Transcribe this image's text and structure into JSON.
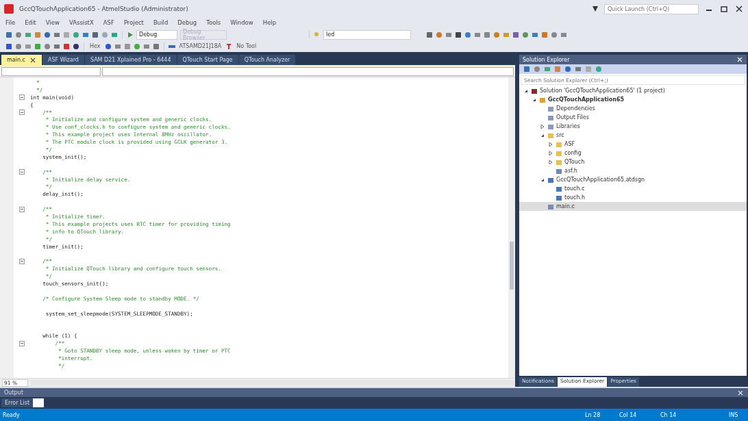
{
  "window": {
    "title": "GccQTouchApplication65 - AtmelStudio (Administrator)",
    "quick_launch_placeholder": "Quick Launch (Ctrl+Q)"
  },
  "menu": [
    "File",
    "Edit",
    "View",
    "VAssistX",
    "ASF",
    "Project",
    "Build",
    "Debug",
    "Tools",
    "Window",
    "Help"
  ],
  "toolbar": {
    "configuration": "Debug",
    "debug_browser": "Debug Browser",
    "find_value": "led",
    "hex_label": "Hex",
    "device": "ATSAMD21J18A",
    "tool": "No Tool"
  },
  "document_tabs": [
    {
      "label": "main.c",
      "selected": true
    },
    {
      "label": "ASF Wizard",
      "selected": false
    },
    {
      "label": "SAM D21 Xplained Pro - 6444",
      "selected": false
    },
    {
      "label": "QTouch Start Page",
      "selected": false
    },
    {
      "label": "QTouch Analyzer",
      "selected": false
    }
  ],
  "editor": {
    "zoom": "91 %",
    "lines": [
      {
        "kind": "comment",
        "text": "  *",
        "foldable": false
      },
      {
        "kind": "comment",
        "text": "  */",
        "foldable": false
      },
      {
        "kind": "code",
        "text": "int main(void)",
        "foldable": true
      },
      {
        "kind": "code",
        "text": "{",
        "foldable": false
      },
      {
        "kind": "comment",
        "text": "    /**",
        "foldable": true
      },
      {
        "kind": "comment",
        "text": "     * Initialize and configure system and generic clocks.",
        "foldable": false
      },
      {
        "kind": "comment",
        "text": "     * Use conf_clocks.h to configure system and generic clocks.",
        "foldable": false
      },
      {
        "kind": "comment",
        "text": "     * This example project uses Internal 8MHz oscillator.",
        "foldable": false
      },
      {
        "kind": "comment",
        "text": "     * The PTC module clock is provided using GCLK generator 3.",
        "foldable": false
      },
      {
        "kind": "comment",
        "text": "     */",
        "foldable": false
      },
      {
        "kind": "code",
        "text": "    system_init();",
        "foldable": false
      },
      {
        "kind": "blank",
        "foldable": false
      },
      {
        "kind": "comment",
        "text": "    /**",
        "foldable": true
      },
      {
        "kind": "comment",
        "text": "     * Initialize delay service.",
        "foldable": false
      },
      {
        "kind": "comment",
        "text": "     */",
        "foldable": false
      },
      {
        "kind": "code",
        "text": "    delay_init();",
        "foldable": false
      },
      {
        "kind": "blank",
        "foldable": false
      },
      {
        "kind": "comment",
        "text": "    /**",
        "foldable": true
      },
      {
        "kind": "comment",
        "text": "     * Initialize timer.",
        "foldable": false
      },
      {
        "kind": "comment",
        "text": "     * This example projects uses RTC timer for providing timing",
        "foldable": false
      },
      {
        "kind": "comment",
        "text": "     * info to QTouch library.",
        "foldable": false
      },
      {
        "kind": "comment",
        "text": "     */",
        "foldable": false
      },
      {
        "kind": "code",
        "text": "    timer_init();",
        "foldable": false
      },
      {
        "kind": "blank",
        "foldable": false
      },
      {
        "kind": "comment",
        "text": "    /**",
        "foldable": true
      },
      {
        "kind": "comment",
        "text": "     * Initialize QTouch library and configure touch sensors.",
        "foldable": false
      },
      {
        "kind": "comment",
        "text": "     */",
        "foldable": false
      },
      {
        "kind": "code",
        "text": "    touch_sensors_init();",
        "foldable": false
      },
      {
        "kind": "blank",
        "foldable": false
      },
      {
        "kind": "comment",
        "text": "    /* Configure System Sleep mode to standby MODE. */",
        "foldable": false
      },
      {
        "kind": "blank",
        "foldable": false
      },
      {
        "kind": "code",
        "text": "     system_set_sleepmode(SYSTEM_SLEEPMODE_STANDBY);",
        "foldable": false
      },
      {
        "kind": "blank",
        "foldable": false
      },
      {
        "kind": "blank",
        "foldable": false
      },
      {
        "kind": "code",
        "text": "    while (1) {",
        "foldable": false
      },
      {
        "kind": "comment",
        "text": "        /**",
        "foldable": true
      },
      {
        "kind": "comment",
        "text": "         * Goto STANDBY sleep mode, unless woken by timer or PTC",
        "foldable": false
      },
      {
        "kind": "comment",
        "text": "         *interrupt.",
        "foldable": false
      },
      {
        "kind": "comment",
        "text": "         */",
        "foldable": false
      }
    ]
  },
  "solution_explorer": {
    "title": "Solution Explorer",
    "search_placeholder": "Search Solution Explorer (Ctrl+;)",
    "tree": [
      {
        "kind": "solution",
        "label": "Solution 'GccQTouchApplication65' (1 project)",
        "expanded": true,
        "selected": false,
        "children": [
          {
            "kind": "project",
            "label": "GccQTouchApplication65",
            "expanded": true,
            "selected": false,
            "children": [
              {
                "kind": "ref",
                "label": "Dependencies",
                "selected": false
              },
              {
                "kind": "ref",
                "label": "Output Files",
                "selected": false
              },
              {
                "kind": "ref",
                "label": "Libraries",
                "expanded": false,
                "selected": false
              },
              {
                "kind": "folder",
                "label": "src",
                "expanded": true,
                "selected": false,
                "children": [
                  {
                    "kind": "folder",
                    "label": "ASF",
                    "expanded": false,
                    "selected": false
                  },
                  {
                    "kind": "folder",
                    "label": "config",
                    "expanded": false,
                    "selected": false
                  },
                  {
                    "kind": "folder",
                    "label": "QTouch",
                    "expanded": false,
                    "selected": false
                  },
                  {
                    "kind": "header",
                    "label": "asf.h",
                    "selected": false
                  }
                ]
              },
              {
                "kind": "design",
                "label": "GccQTouchApplication65.atdsgn",
                "expanded": true,
                "selected": false,
                "children": [
                  {
                    "kind": "file",
                    "label": "touch.c",
                    "selected": false
                  },
                  {
                    "kind": "file",
                    "label": "touch.h",
                    "selected": false
                  }
                ]
              },
              {
                "kind": "source",
                "label": "main.c",
                "selected": true
              }
            ]
          }
        ]
      }
    ],
    "bottom_tabs": [
      {
        "label": "Notifications",
        "selected": false
      },
      {
        "label": "Solution Explorer",
        "selected": true
      },
      {
        "label": "Properties",
        "selected": false
      }
    ]
  },
  "output": {
    "title": "Output",
    "tabs": [
      {
        "label": "Error List",
        "selected": false
      }
    ]
  },
  "status_bar": {
    "message": "Ready",
    "line": "Ln 28",
    "column": "Col 14",
    "char": "Ch 14",
    "mode": "INS"
  }
}
